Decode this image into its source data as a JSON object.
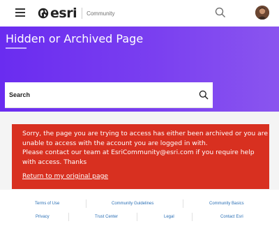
{
  "header": {
    "logo_text": "esri",
    "logo_sub": "Community",
    "icons": {
      "menu": "hamburger-menu-icon",
      "globe": "globe-icon",
      "search": "search-icon",
      "avatar": "user-avatar"
    }
  },
  "hero": {
    "title": "Hidden or Archived Page"
  },
  "search": {
    "placeholder": "Search"
  },
  "error": {
    "line1": "Sorry, the page you are trying to access has either been archived or you are unable to access with the account you are logged in with.",
    "line2": "Please contact our team at EsriCommunity@esri.com if you require help with access. Thanks",
    "link": "Return to my original page"
  },
  "footer": {
    "terms": "Terms of Use",
    "guidelines": "Community Guidelines",
    "basics": "Community Basics",
    "privacy": "Privacy",
    "trust": "Trust Center",
    "legal": "Legal",
    "contact": "Contact Esri"
  },
  "colors": {
    "hero_start": "#6a2cf0",
    "hero_end": "#8a55ef",
    "error_bg": "#d83020",
    "footer_link": "#2a6fb5"
  }
}
